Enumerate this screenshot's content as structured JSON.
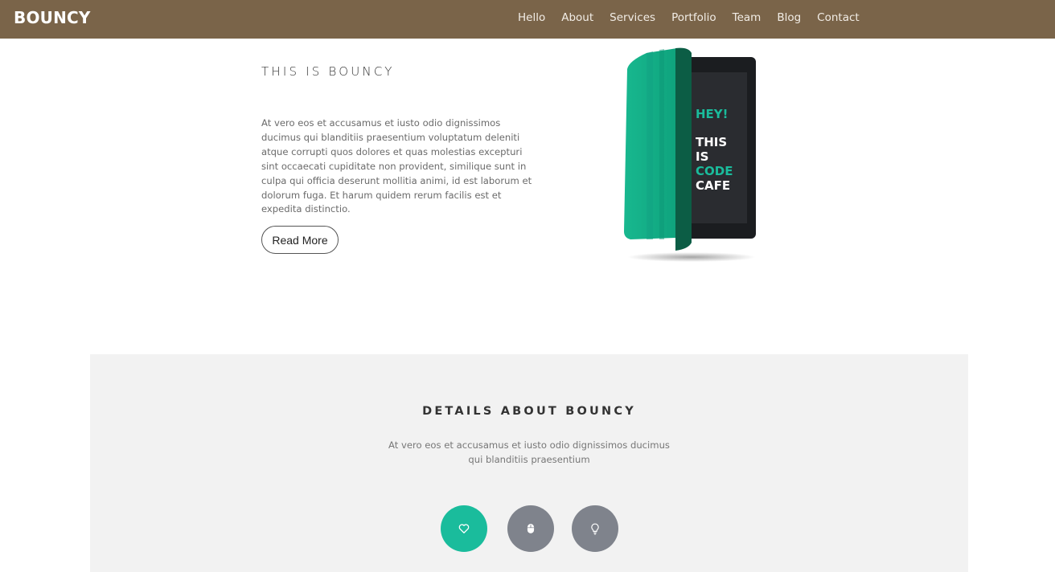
{
  "header": {
    "brand": "BOUNCY",
    "nav": [
      "Hello",
      "About",
      "Services",
      "Portfolio",
      "Team",
      "Blog",
      "Contact"
    ],
    "bg_color": "#7a6449"
  },
  "hero": {
    "title": "THIS IS BOUNCY",
    "text": "At vero eos et accusamus et iusto odio dignissimos ducimus qui blanditiis praesentium voluptatum deleniti atque corrupti quos dolores et quas molestias excepturi sint occaecati cupiditate non provident, similique sunt in culpa qui officia deserunt mollitia animi, id est laborum et dolorum fuga. Et harum quidem rerum facilis est et expedita distinctio.",
    "button": "Read More",
    "tablet_screen": {
      "line1": "HEY!",
      "line2": "THIS",
      "line3": "IS",
      "line4": "CODE",
      "line5": "CAFE"
    }
  },
  "details": {
    "title": "DETAILS ABOUT BOUNCY",
    "text": "At vero eos et accusamus et iusto odio dignissimos ducimus qui blanditiis praesentium",
    "icons": [
      {
        "name": "heart-icon",
        "color": "#1abc9c"
      },
      {
        "name": "mouse-icon",
        "color": "#7f838c"
      },
      {
        "name": "lightbulb-icon",
        "color": "#7f838c"
      }
    ]
  }
}
